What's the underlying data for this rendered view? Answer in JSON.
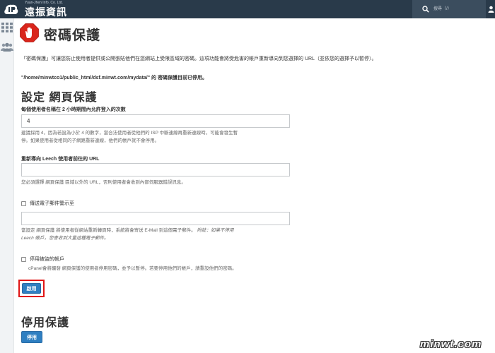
{
  "brand": {
    "name_en": "Yuan-Jhen Info. Co. Ltd.",
    "name_zh": "遠振資訊"
  },
  "search": {
    "placeholder": "搜尋（/）"
  },
  "page": {
    "title": "密碼保護"
  },
  "intro": "「密碼保護」可讓您防止使用者提供或公開張貼他們在您網站上受限區域的密碼。這項功能會將受危害的帳戶重新導向到您選擇的 URL（並依您的選擇予以暫停）。",
  "status": "\"/home/minwtco1/public_html/dsf.minwt.com/mydata/\" 的 密碼保護目前已停用。",
  "settings": {
    "title": "設定 網頁保護",
    "logins_label": "每個使用者名稱在 2 小時期間內允許登入的次數",
    "logins_value": "4",
    "logins_hint_1": "建議採用 4，因為若設為小於 4 的數字，當合法使用者從他們的 ISP 中斷連線再重新連線時，可能會發生暫",
    "logins_hint_2": "停。如果使用者從相同的子網路重新連線，他們的帳戶就不會停用。",
    "redirect_label": "重新導向 Leech 使用者前往的 URL",
    "redirect_value": "",
    "redirect_hint": "您必須選擇 網頁保護 區域以外的 URL，否則使用者會收到內部伺服器錯誤訊息。",
    "email_label": "傳送電子郵件警示至",
    "email_value": "",
    "email_hint_1": "當設定 網頁保護 將使用者從網站重新轉頁時，系統將會寄送 E-Mail 到這個電子郵件。",
    "email_note_1": "附註：如果不停用",
    "email_note_2": "Leech 帳戶，您會收到大量這種電子郵件。",
    "disable_label": "停用被盜的帳戶",
    "disable_hint": "cPanel會將觸發 網頁保護的使用者停用密碼，並予以暫停。若要停用他們的帳戶，請重設他們的密碼。",
    "enable_button": "啟用"
  },
  "disable_section": {
    "title": "停用保護",
    "button": "停用"
  },
  "watermark": "minwt.com",
  "colors": {
    "topbar": "#293a4a",
    "accent_button": "#2f7fc1",
    "highlight": "#e01515",
    "stop_sign": "#d9261c"
  },
  "icons": [
    "cpanel-logo-icon",
    "search-icon",
    "user-icon",
    "apps-grid-icon",
    "users-icon",
    "stop-hand-icon"
  ]
}
